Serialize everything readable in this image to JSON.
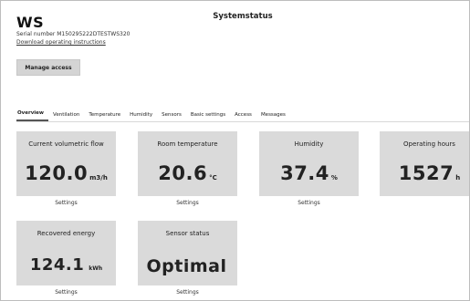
{
  "header": {
    "device_name": "WS",
    "page_title": "Systemstatus",
    "serial_number": "Serial number M150295222DTESTWS320",
    "download_link": "Download operating instructions",
    "manage_access_label": "Manage access"
  },
  "tabs": [
    {
      "label": "Overview",
      "active": true
    },
    {
      "label": "Ventilation"
    },
    {
      "label": "Temperature"
    },
    {
      "label": "Humidity"
    },
    {
      "label": "Sensors"
    },
    {
      "label": "Basic settings"
    },
    {
      "label": "Access"
    },
    {
      "label": "Messages"
    }
  ],
  "tiles": [
    {
      "title": "Current volumetric flow",
      "value": "120.0",
      "unit": "m3/h",
      "action": "Settings"
    },
    {
      "title": "Room temperature",
      "value": "20.6",
      "unit": "°C",
      "action": "Settings"
    },
    {
      "title": "Humidity",
      "value": "37.4",
      "unit": "%",
      "action": "Settings"
    },
    {
      "title": "Operating hours",
      "value": "1527",
      "unit": "h",
      "action": ""
    },
    {
      "title": "Recovered energy",
      "value": "124.1",
      "unit": "kWh",
      "action": "Settings"
    },
    {
      "title": "Sensor status",
      "value": "Optimal",
      "unit": "",
      "action": "Settings"
    }
  ],
  "colors": {
    "tile_background": "#dadada",
    "button_background": "#d4d4d4"
  }
}
